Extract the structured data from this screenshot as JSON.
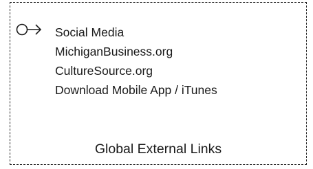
{
  "links": [
    "Social Media",
    "MichiganBusiness.org",
    "CultureSource.org",
    "Download Mobile App / iTunes"
  ],
  "caption": "Global External Links",
  "icons": {
    "link_marker": "circle-arrow-icon"
  },
  "colors": {
    "stroke": "#1a1a1a",
    "background": "#ffffff"
  }
}
